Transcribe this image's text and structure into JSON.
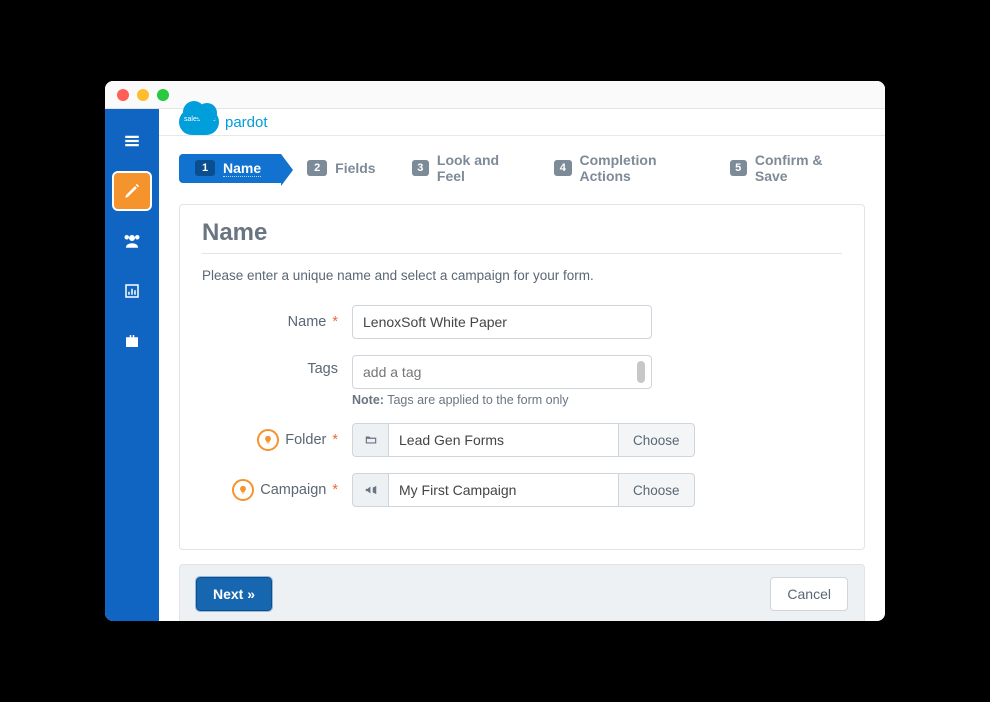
{
  "logo": {
    "brand": "salesforce",
    "product": "pardot"
  },
  "sidebar": {
    "items": [
      {
        "name": "menu-icon"
      },
      {
        "name": "edit-icon"
      },
      {
        "name": "users-icon"
      },
      {
        "name": "chart-icon"
      },
      {
        "name": "briefcase-icon"
      }
    ],
    "active_index": 1
  },
  "stepper": {
    "active_index": 0,
    "steps": [
      {
        "num": "1",
        "label": "Name"
      },
      {
        "num": "2",
        "label": "Fields"
      },
      {
        "num": "3",
        "label": "Look and Feel"
      },
      {
        "num": "4",
        "label": "Completion Actions"
      },
      {
        "num": "5",
        "label": "Confirm & Save"
      }
    ]
  },
  "panel": {
    "title": "Name",
    "intro": "Please enter a unique name and select a campaign for your form.",
    "name": {
      "label": "Name",
      "value": "LenoxSoft White Paper"
    },
    "tags": {
      "label": "Tags",
      "placeholder": "add a tag",
      "note_label": "Note:",
      "note_text": "Tags are applied to the form only"
    },
    "folder": {
      "label": "Folder",
      "value": "Lead Gen Forms",
      "button": "Choose"
    },
    "campaign": {
      "label": "Campaign",
      "value": "My First Campaign",
      "button": "Choose"
    }
  },
  "footer": {
    "next": "Next »",
    "cancel": "Cancel"
  }
}
